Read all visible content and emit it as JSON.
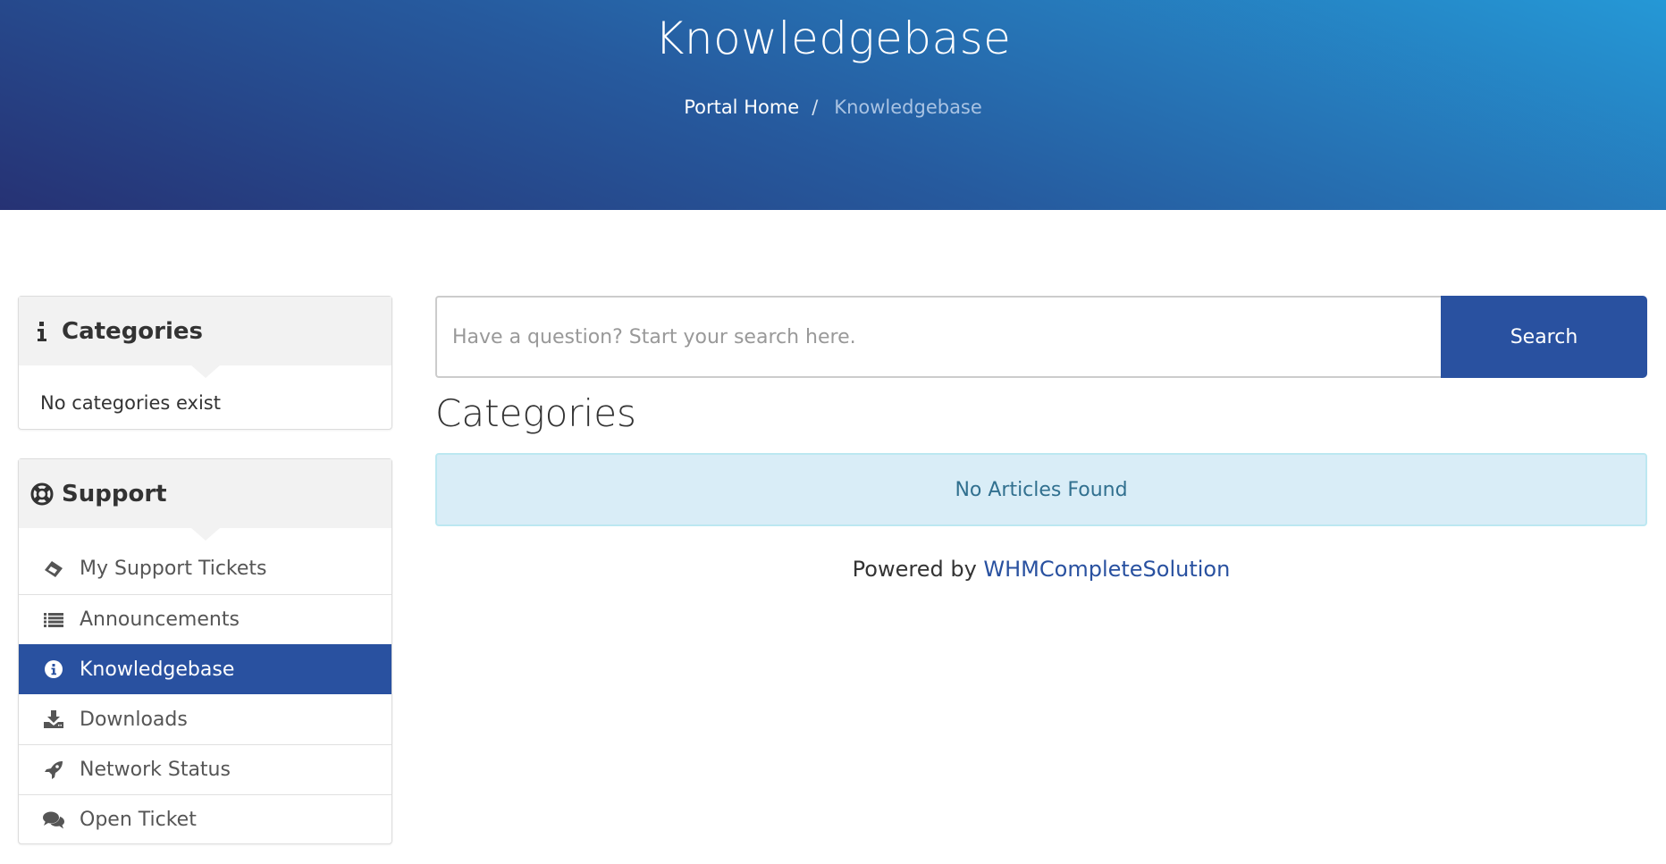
{
  "header": {
    "title": "Knowledgebase",
    "breadcrumb": [
      {
        "label": "Portal Home"
      },
      {
        "label": "Knowledgebase"
      }
    ],
    "breadcrumb_separator": "/"
  },
  "sidebar": {
    "categories_panel": {
      "title": "Categories",
      "icon": "info-icon",
      "empty_text": "No categories exist"
    },
    "support_panel": {
      "title": "Support",
      "icon": "life-ring-icon",
      "items": [
        {
          "label": "My Support Tickets",
          "icon": "ticket-icon",
          "active": false
        },
        {
          "label": "Announcements",
          "icon": "list-icon",
          "active": false
        },
        {
          "label": "Knowledgebase",
          "icon": "info-circle-icon",
          "active": true
        },
        {
          "label": "Downloads",
          "icon": "download-icon",
          "active": false
        },
        {
          "label": "Network Status",
          "icon": "rocket-icon",
          "active": false
        },
        {
          "label": "Open Ticket",
          "icon": "comments-icon",
          "active": false
        }
      ]
    }
  },
  "main": {
    "search": {
      "placeholder": "Have a question? Start your search here.",
      "value": "",
      "button_label": "Search"
    },
    "section_title": "Categories",
    "alert_text": "No Articles Found",
    "footer": {
      "prefix": "Powered by ",
      "link_label": "WHMCompleteSolution"
    }
  },
  "colors": {
    "accent": "#2951a0",
    "alert_bg": "#d9edf7",
    "alert_text": "#31708f",
    "header_gradient_start": "#263274",
    "header_gradient_end": "#2598d6"
  }
}
